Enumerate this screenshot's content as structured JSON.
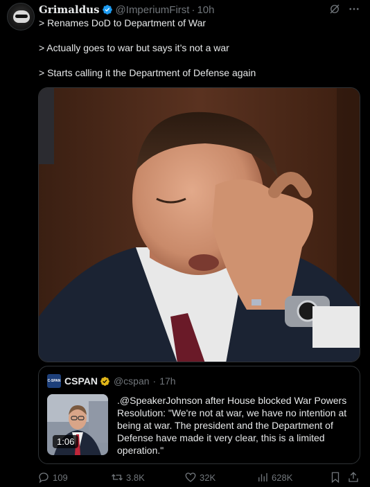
{
  "author": {
    "name": "Grimaldus",
    "handle": "@ImperiumFirst",
    "separator": "·",
    "time": "10h"
  },
  "tweet": {
    "lines": [
      "> Renames DoD to Department of War",
      "> Actually goes to war but says it’s not a war",
      "> Starts calling it the Department of Defense again"
    ]
  },
  "quote": {
    "logo_text": "C-SPAN",
    "name": "CSPAN",
    "handle": "@cspan",
    "separator": "·",
    "time": "17h",
    "video_duration": "1:06",
    "text": ".@SpeakerJohnson after House blocked War Powers Resolution: \"We're not at war, we have no intention at being at war. The president and the Department of Defense have made it very clear, this is a limited operation.\""
  },
  "actions": {
    "replies": "109",
    "reposts": "3.8K",
    "likes": "32K",
    "views": "628K"
  },
  "colors": {
    "background": "#000000",
    "text": "#e7e9ea",
    "muted": "#71767b",
    "verified_blue": "#1d9bf0",
    "verified_gold": "#e2b719",
    "border": "#2f3336"
  },
  "icons": [
    "grok-icon",
    "more-icon",
    "verified-badge-icon",
    "reply-icon",
    "repost-icon",
    "like-icon",
    "views-icon",
    "bookmark-icon",
    "share-icon"
  ]
}
